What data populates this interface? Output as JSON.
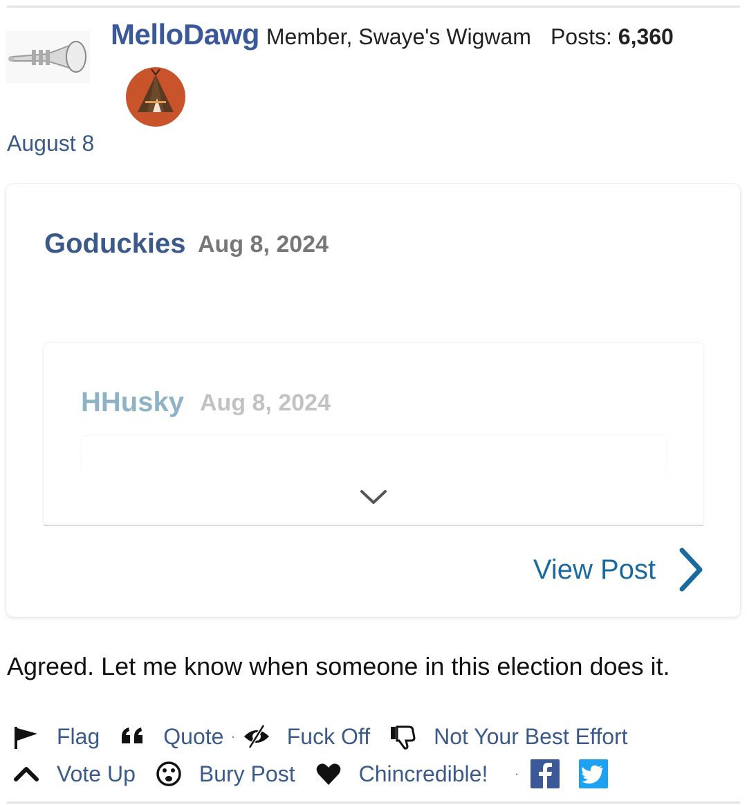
{
  "author": {
    "name": "MelloDawg",
    "role": "Member, Swaye's Wigwam",
    "posts_label": "Posts:",
    "posts_count": "6,360",
    "avatar_icon": "trumpet-icon",
    "rank_icon": "teepee-icon",
    "rank_color": "#c9532b"
  },
  "post_date": "August 8",
  "quote": {
    "author": "Goduckies",
    "date": "Aug 8, 2024",
    "nested": {
      "author": "HHusky",
      "date": "Aug 8, 2024"
    },
    "expand_icon": "chevron-down-icon",
    "view_post_label": "View Post",
    "view_post_icon": "chevron-right-icon"
  },
  "body": "Agreed. Let me know when someone in this election does it.",
  "reactions": {
    "row1": [
      {
        "label": "Flag",
        "icon": "flag-icon"
      },
      {
        "label": "Quote",
        "icon": "quote-icon"
      },
      {
        "label": "Fuck Off",
        "icon": "hide-icon"
      },
      {
        "label": "Not Your Best Effort",
        "icon": "thumbs-down-icon"
      }
    ],
    "row2": [
      {
        "label": "Vote Up",
        "icon": "arrow-up-icon"
      },
      {
        "label": "Bury Post",
        "icon": "bury-face-icon"
      },
      {
        "label": "Chincredible!",
        "icon": "heart-icon"
      }
    ],
    "share": [
      "facebook-icon",
      "twitter-icon"
    ],
    "separator": "·"
  },
  "colors": {
    "link": "#3b5a8a",
    "view_post": "#1a6aa0",
    "facebook": "#3b5998",
    "twitter": "#1da1f2"
  }
}
